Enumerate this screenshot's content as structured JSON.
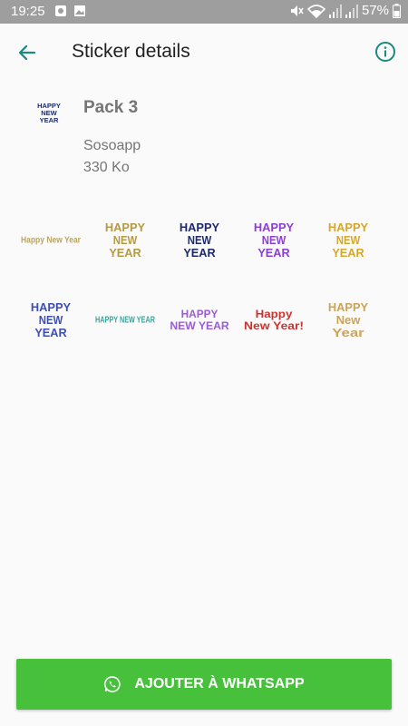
{
  "status_bar": {
    "time": "19:25",
    "battery": "57%"
  },
  "header": {
    "title": "Sticker details"
  },
  "pack": {
    "tray_text": [
      "HAPPY",
      "NEW",
      "YEAR"
    ],
    "name": "Pack 3",
    "publisher": "Sosoapp",
    "size": "330 Ko"
  },
  "stickers": [
    {
      "lines": [
        "Happy New Year"
      ],
      "color": "#b8a56a"
    },
    {
      "lines": [
        "HAPPY",
        "NEW",
        "YEAR"
      ],
      "color": "#b49a45"
    },
    {
      "lines": [
        "HAPPY",
        "NEW",
        "YEAR"
      ],
      "color": "#1f2a6b"
    },
    {
      "lines": [
        "HAPPY",
        "NEW",
        "YEAR"
      ],
      "color": "#8a3fd1"
    },
    {
      "lines": [
        "HAPPY",
        "NEW",
        "YEAR"
      ],
      "color": "#d4a72c"
    },
    {
      "lines": [
        "HAPPY",
        "NEW",
        "YEAR"
      ],
      "color": "#3f4fb0"
    },
    {
      "lines": [
        "HAPPY NEW YEAR"
      ],
      "color": "#3aa39b"
    },
    {
      "lines": [
        "HAPPY",
        "NEW YEAR"
      ],
      "color": "#9c5bd6"
    },
    {
      "lines": [
        "Happy",
        "New Year!"
      ],
      "color": "#d0312d"
    },
    {
      "lines": [
        "HAPPY",
        "New",
        "Year"
      ],
      "color": "#c9a45a"
    }
  ],
  "action": {
    "label": "AJOUTER À WHATSAPP"
  },
  "colors": {
    "accent": "#1b8a7e",
    "button": "#47c03c",
    "status_bar": "#9e9e9e"
  }
}
